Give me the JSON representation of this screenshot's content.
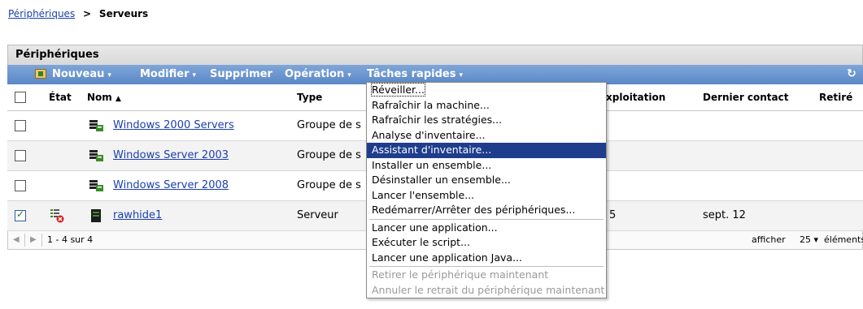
{
  "breadcrumb": {
    "parent": "Périphériques",
    "separator": ">",
    "current": "Serveurs"
  },
  "panel": {
    "title": "Périphériques"
  },
  "toolbar": {
    "new": "Nouveau",
    "edit": "Modifier",
    "delete": "Supprimer",
    "action": "Opération",
    "quick_tasks": "Tâches rapides",
    "caret": "▾",
    "refresh": "↻"
  },
  "columns": {
    "state": "État",
    "name": "Nom",
    "sort_indicator": "▲",
    "type": "Type",
    "os": "xploitation",
    "last_contact": "Dernier contact",
    "retired": "Retiré"
  },
  "rows": [
    {
      "name": "Windows 2000 Servers",
      "type": "Groupe de s",
      "os": "",
      "last_contact": "",
      "checked": false
    },
    {
      "name": "Windows Server 2003",
      "type": "Groupe de s",
      "os": "",
      "last_contact": "",
      "checked": false
    },
    {
      "name": "Windows Server 2008",
      "type": "Groupe de s",
      "os": "",
      "last_contact": "",
      "checked": false
    },
    {
      "name": "rawhide1",
      "type": "Serveur",
      "os": "5",
      "last_contact": "sept. 12",
      "checked": true
    }
  ],
  "pager": {
    "range": "1 - 4 sur 4",
    "show_label": "afficher",
    "page_size": "25",
    "caret": "▾",
    "items_label": "éléments"
  },
  "menu": {
    "items": [
      "Réveiller...",
      "Rafraîchir la machine...",
      "Rafraîchir les stratégies...",
      "Analyse d'inventaire...",
      "Assistant d'inventaire...",
      "Installer un ensemble...",
      "Désinstaller un ensemble...",
      "Lancer l'ensemble...",
      "Redémarrer/Arrêter des périphériques...",
      "Lancer une application...",
      "Exécuter le script...",
      "Lancer une application Java...",
      "Retirer le périphérique maintenant",
      "Annuler le retrait du périphérique maintenant"
    ]
  },
  "colors": {
    "toolbar": "#5a87c6",
    "link": "#1b3fae",
    "menu_highlight": "#1f3d8c"
  }
}
